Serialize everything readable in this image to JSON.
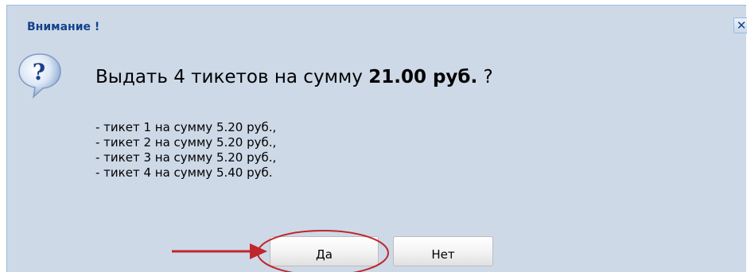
{
  "dialog": {
    "title": "Внимание !",
    "close_symbol": "✕",
    "icon": "question-icon",
    "question_prefix": "Выдать 4 тикетов на сумму ",
    "question_amount": "21.00 руб.",
    "question_suffix": " ?",
    "tickets": [
      "- тикет 1 на сумму 5.20 руб.,",
      "- тикет 2 на сумму 5.20 руб.,",
      "- тикет 3 на сумму 5.20 руб.,",
      "- тикет 4 на сумму 5.40 руб."
    ],
    "buttons": {
      "yes": "Да",
      "no": "Нет"
    }
  },
  "colors": {
    "dialog_bg": "#ced9e7",
    "title": "#15428b",
    "annotation": "#c0272d"
  }
}
